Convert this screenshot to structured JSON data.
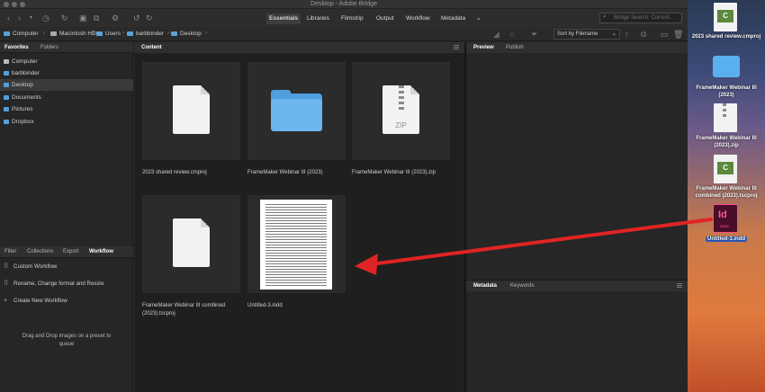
{
  "window": {
    "title": "Desktop - Adobe Bridge"
  },
  "workspaces": [
    {
      "label": "Essentials"
    },
    {
      "label": "Libraries"
    },
    {
      "label": "Filmstrip"
    },
    {
      "label": "Output"
    },
    {
      "label": "Workflow"
    },
    {
      "label": "Metadata"
    }
  ],
  "search": {
    "placeholder": "Bridge Search: Current..."
  },
  "breadcrumb": [
    {
      "label": "Computer"
    },
    {
      "label": "Macintosh HD"
    },
    {
      "label": "Users"
    },
    {
      "label": "barbbinder"
    },
    {
      "label": "Desktop"
    }
  ],
  "sort": {
    "label": "Sort by Filename"
  },
  "left_tabs": {
    "favorites": "Favorites",
    "folders": "Folders"
  },
  "favorites": [
    {
      "label": "Computer"
    },
    {
      "label": "barbbinder"
    },
    {
      "label": "Desktop"
    },
    {
      "label": "Documents"
    },
    {
      "label": "Pictures"
    },
    {
      "label": "Dropbox"
    }
  ],
  "lower_tabs": {
    "filter": "Filter",
    "collections": "Collections",
    "export": "Export",
    "workflow": "Workflow"
  },
  "workflows": [
    {
      "label": "Custom Workflow"
    },
    {
      "label": "Rename, Change format and Resize"
    },
    {
      "label": "Create New Workflow"
    }
  ],
  "drop_hint": "Drag and Drop images on a preset to queue",
  "content": {
    "tab": "Content",
    "items": [
      {
        "name": "2023 shared review.cmproj"
      },
      {
        "name": "FrameMaker Webinar III (2023)"
      },
      {
        "name": "FrameMaker Webinar III (2023).zip"
      },
      {
        "name": "FrameMaker Webinar III combined (2023).tscproj"
      },
      {
        "name": "Untitled-3.indd"
      }
    ],
    "zip_label": "ZIP"
  },
  "preview_tabs": {
    "preview": "Preview",
    "publish": "Publish"
  },
  "metadata_tabs": {
    "metadata": "Metadata",
    "keywords": "Keywords"
  },
  "desktop": [
    {
      "label": "2023 shared review.cmproj",
      "badge": "C"
    },
    {
      "label": "FrameMaker Webinar III (2023)"
    },
    {
      "label": "FrameMaker Webinar III (2023).zip"
    },
    {
      "label": "FrameMaker Webinar III combined (2023).tscproj",
      "badge": "C"
    },
    {
      "label": "Untitled-3.indd",
      "icon_text": "Id",
      "icon_sub": "INDD"
    }
  ],
  "colors": {
    "accent_arrow": "#e02424",
    "folder_blue": "#4f9fe0",
    "indesign": "#ff4f8a"
  }
}
